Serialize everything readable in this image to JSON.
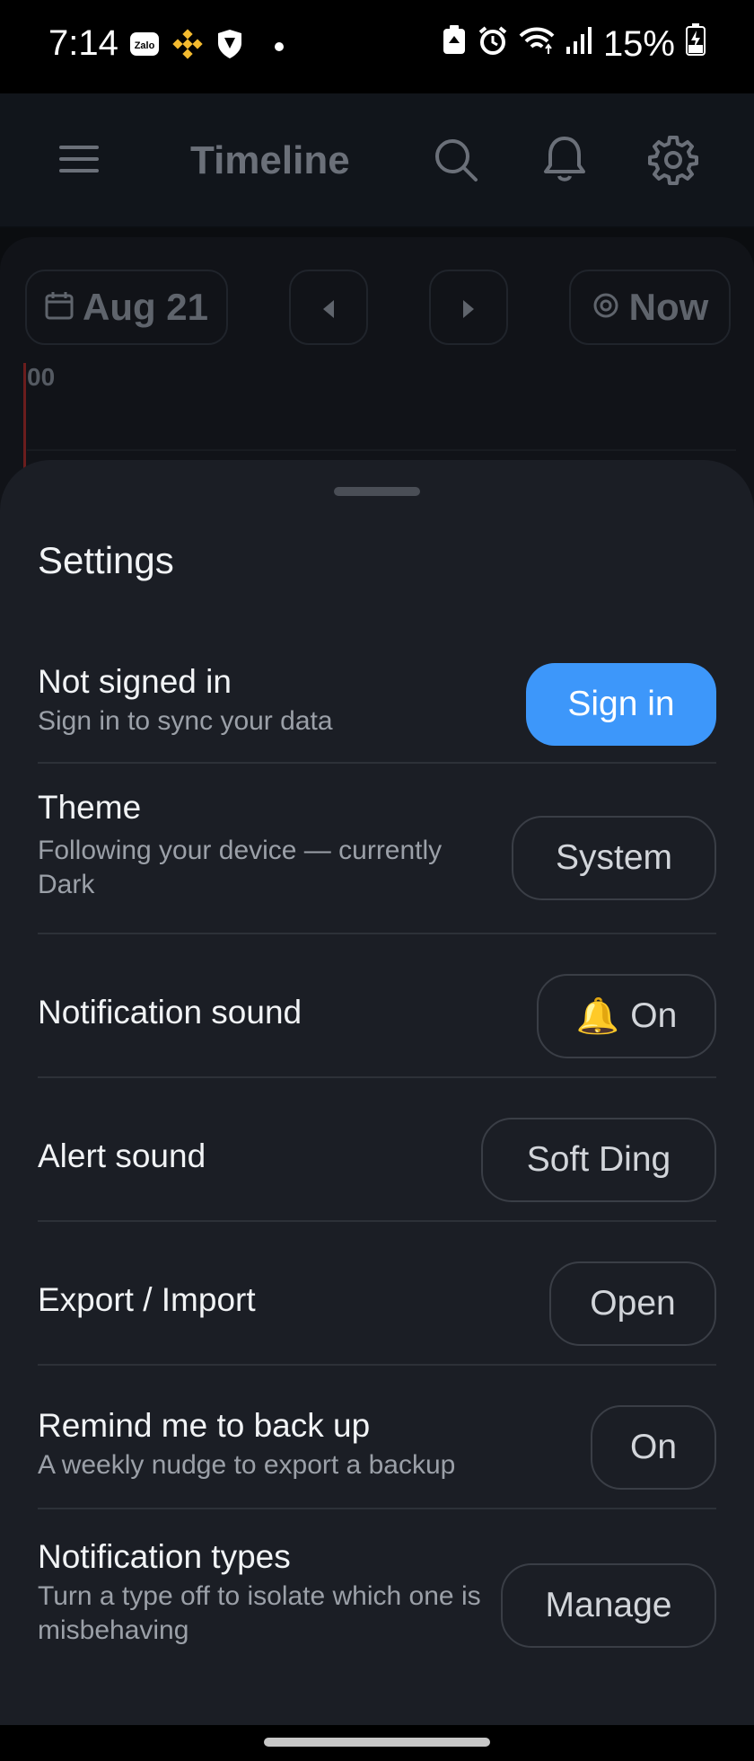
{
  "status_bar": {
    "time": "7:14",
    "battery": "15%",
    "zalo_label": "Zalo"
  },
  "app_bar": {
    "title": "Timeline"
  },
  "timeline": {
    "date": "Aug 21",
    "now_label": "Now",
    "hour_label": "00"
  },
  "settings": {
    "title": "Settings",
    "account": {
      "title": "Not signed in",
      "subtitle": "Sign in to sync your data",
      "button": "Sign in"
    },
    "theme": {
      "title": "Theme",
      "subtitle": "Following your device — currently Dark",
      "button": "System"
    },
    "notification_sound": {
      "title": "Notification sound",
      "button_icon": "🔔",
      "button": "On"
    },
    "alert_sound": {
      "title": "Alert sound",
      "button": "Soft Ding"
    },
    "export_import": {
      "title": "Export / Import",
      "button": "Open"
    },
    "backup_reminder": {
      "title": "Remind me to back up",
      "subtitle": "A weekly nudge to export a backup",
      "button": "On"
    },
    "notification_types": {
      "title": "Notification types",
      "subtitle": "Turn a type off to isolate which one is misbehaving",
      "button": "Manage"
    }
  },
  "colors": {
    "accent": "#3d97fa",
    "sheet_bg": "#1b1e25",
    "background": "#111318"
  }
}
